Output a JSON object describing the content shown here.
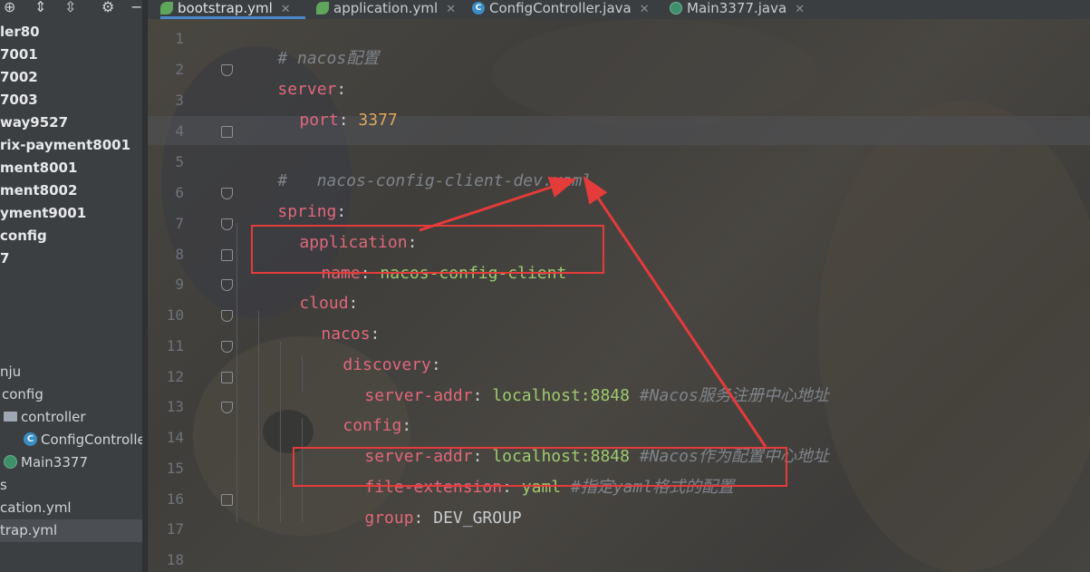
{
  "sidebar": {
    "toolbar_icons": [
      "crosshair-icon",
      "expand-all-icon",
      "collapse-all-icon",
      "gear-icon",
      "minimize-icon"
    ],
    "items": [
      {
        "label": "ler80",
        "bold": true
      },
      {
        "label": "7001",
        "bold": true
      },
      {
        "label": "7002",
        "bold": true
      },
      {
        "label": "7003",
        "bold": true
      },
      {
        "label": "way9527",
        "bold": true
      },
      {
        "label": "rix-payment8001",
        "bold": true
      },
      {
        "label": "ment8001",
        "bold": true
      },
      {
        "label": "ment8002",
        "bold": true
      },
      {
        "label": "yment9001",
        "bold": true
      },
      {
        "label": "config",
        "bold": true
      },
      {
        "label": "7",
        "bold": true
      },
      {
        "label": "nju",
        "bold": false
      },
      {
        "label": "config",
        "bold": false
      },
      {
        "label": "controller",
        "bold": false,
        "icon": "folder-icon"
      },
      {
        "label": "ConfigController",
        "bold": false,
        "icon": "class-icon"
      },
      {
        "label": "Main3377",
        "bold": false,
        "icon": "main-class-icon"
      },
      {
        "label": "s",
        "bold": false
      },
      {
        "label": "cation.yml",
        "bold": false
      },
      {
        "label": "trap.yml",
        "bold": false,
        "selected": true
      }
    ]
  },
  "tabs": [
    {
      "label": "bootstrap.yml",
      "icon": "yaml-icon",
      "active": true
    },
    {
      "label": "application.yml",
      "icon": "yaml-icon",
      "active": false
    },
    {
      "label": "ConfigController.java",
      "icon": "class-icon",
      "active": false
    },
    {
      "label": "Main3377.java",
      "icon": "main-class-icon",
      "active": false
    }
  ],
  "editor": {
    "line_numbers": [
      "1",
      "2",
      "3",
      "4",
      "5",
      "6",
      "7",
      "8",
      "9",
      "10",
      "11",
      "12",
      "13",
      "14",
      "15",
      "16",
      "17",
      "18"
    ],
    "lines": {
      "l1": {
        "comment": "# nacos配置"
      },
      "l2": {
        "key": "server",
        "colon": ":"
      },
      "l3": {
        "key": "port",
        "colon": ": ",
        "num": "3377"
      },
      "l5": {
        "comment": "#   nacos-config-client-dev.yaml"
      },
      "l6": {
        "key": "spring",
        "colon": ":"
      },
      "l7": {
        "key": "application",
        "colon": ":"
      },
      "l8": {
        "key": "name",
        "colon": ": ",
        "value": "nacos-config-client"
      },
      "l9": {
        "key": "cloud",
        "colon": ":"
      },
      "l10": {
        "key": "nacos",
        "colon": ":"
      },
      "l11": {
        "key": "discovery",
        "colon": ":"
      },
      "l12": {
        "key": "server-addr",
        "colon": ": ",
        "value": "localhost:8848",
        "comment": "#Nacos服务注册中心地址"
      },
      "l13": {
        "key": "config",
        "colon": ":"
      },
      "l14": {
        "key": "server-addr",
        "colon": ": ",
        "value": "localhost:8848",
        "comment": "#Nacos作为配置中心地址"
      },
      "l15": {
        "key": "file-extension",
        "colon": ": ",
        "value": "yaml",
        "comment": "#指定yaml格式的配置"
      },
      "l16": {
        "key": "group",
        "colon": ": ",
        "plain": "DEV_GROUP"
      }
    }
  },
  "colors": {
    "annotation": "#e43b3b",
    "key": "#e0687b",
    "string": "#9dcb6f",
    "number": "#e0a65c",
    "comment": "#7f848b"
  }
}
